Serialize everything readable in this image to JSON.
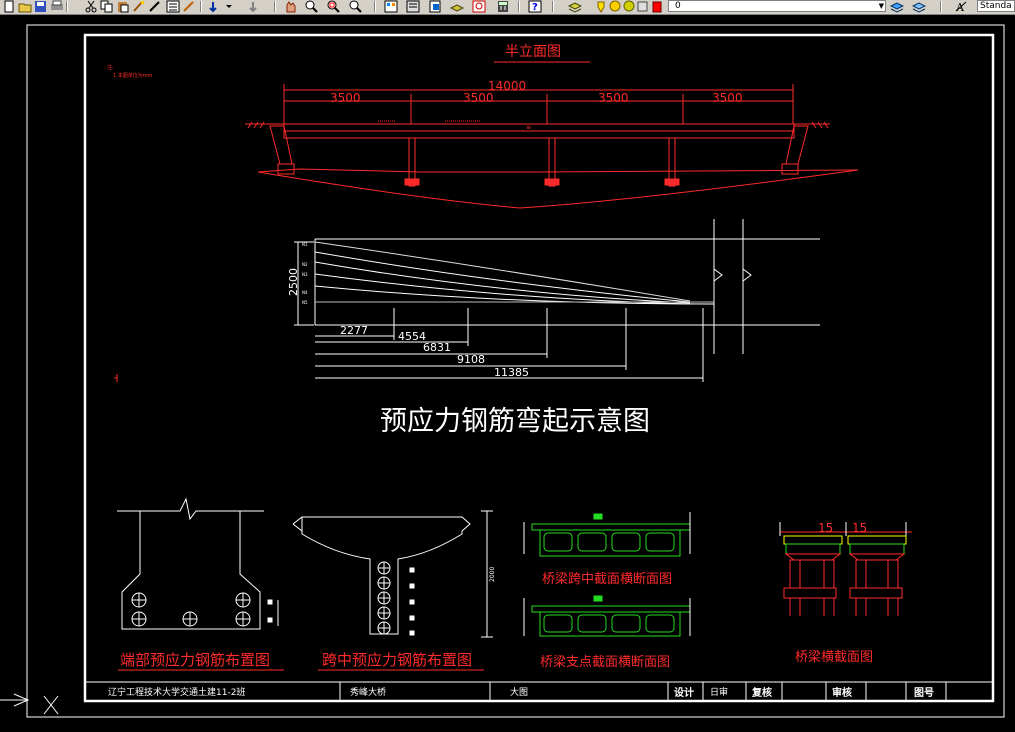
{
  "toolbar": {
    "layer_value": "0",
    "style_value": "Standa",
    "icons": [
      "new-icon",
      "open-icon",
      "save-icon",
      "print-icon",
      "cut-icon",
      "copy-icon",
      "paste-icon",
      "match-properties-icon",
      "undo-icon",
      "redo-icon",
      "pan-icon",
      "zoom-realtime-icon",
      "zoom-window-icon",
      "zoom-previous-icon",
      "properties-icon",
      "design-center-icon",
      "tool-palettes-icon",
      "sheet-set-icon",
      "markup-icon",
      "calculator-icon",
      "help-icon",
      "layer-manager-icon",
      "layer-state-icon",
      "layer-previous-icon",
      "text-style-icon"
    ]
  },
  "drawing": {
    "title_half_elevation": "半立面图",
    "note_heading": "注:",
    "note_line": "1.本图单位为mm",
    "dim_total": "14000",
    "dim_span": "3500",
    "section_title_main": "预应力钢筋弯起示意图",
    "dim_height": "2500",
    "dim_bends": [
      "2277",
      "4554",
      "6831",
      "9108",
      "11385"
    ],
    "tendon_labels": [
      "N1",
      "N2",
      "N3",
      "N4",
      "N5"
    ],
    "dim_vertical": "2000",
    "dim_15": "15",
    "captions": {
      "end_tendon": "端部预应力钢筋布置图",
      "mid_tendon": "跨中预应力钢筋布置图",
      "mid_section": "桥梁跨中截面横断面图",
      "support_section": "桥梁支点截面横断面图",
      "cross_section": "桥梁横截面图"
    }
  },
  "title_block": {
    "school": "辽宁工程技术大学交通土建11-2班",
    "project": "秀峰大桥",
    "sheet": "大图",
    "design": "设计",
    "check_label": "日审",
    "review": "复核",
    "approve": "审核",
    "drawing_no": "图号"
  },
  "colors": {
    "frame": "#ffffff",
    "red": "#ff2a2a",
    "green": "#22dd22",
    "yellow": "#ffff00",
    "toolbar": "#d4d0c8"
  }
}
